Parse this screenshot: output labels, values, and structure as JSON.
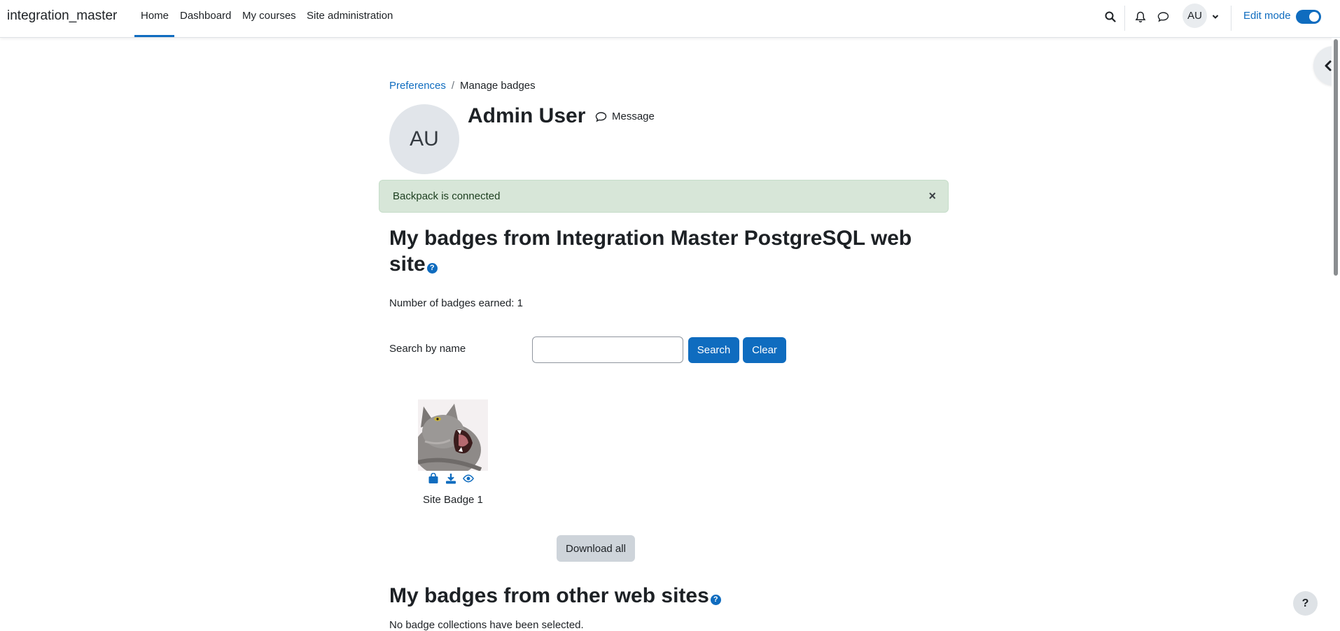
{
  "navbar": {
    "brand": "integration_master",
    "items": [
      {
        "label": "Home"
      },
      {
        "label": "Dashboard"
      },
      {
        "label": "My courses"
      },
      {
        "label": "Site administration"
      }
    ],
    "user_initials": "AU",
    "edit_mode_label": "Edit mode",
    "edit_mode_on": true
  },
  "breadcrumb": {
    "parent": "Preferences",
    "separator": "/",
    "current": "Manage badges"
  },
  "profile": {
    "initials": "AU",
    "name": "Admin User",
    "message_label": "Message"
  },
  "alert": {
    "text": "Backpack is connected",
    "close_symbol": "×"
  },
  "badges_section": {
    "heading": "My badges from Integration Master PostgreSQL web site",
    "earned_text": "Number of badges earned: 1",
    "search_label": "Search by name",
    "search_value": "",
    "search_button": "Search",
    "clear_button": "Clear",
    "badges": [
      {
        "name": "Site Badge 1",
        "actions": [
          "backpack-icon",
          "download-icon",
          "view-icon"
        ]
      }
    ],
    "download_all_button": "Download all"
  },
  "other_section": {
    "heading": "My badges from other web sites",
    "empty_text": "No badge collections have been selected."
  },
  "help_button": "?",
  "colors": {
    "primary": "#0f6cbf",
    "alert_bg": "#d7e6d8",
    "secondary_btn": "#ced4da"
  }
}
